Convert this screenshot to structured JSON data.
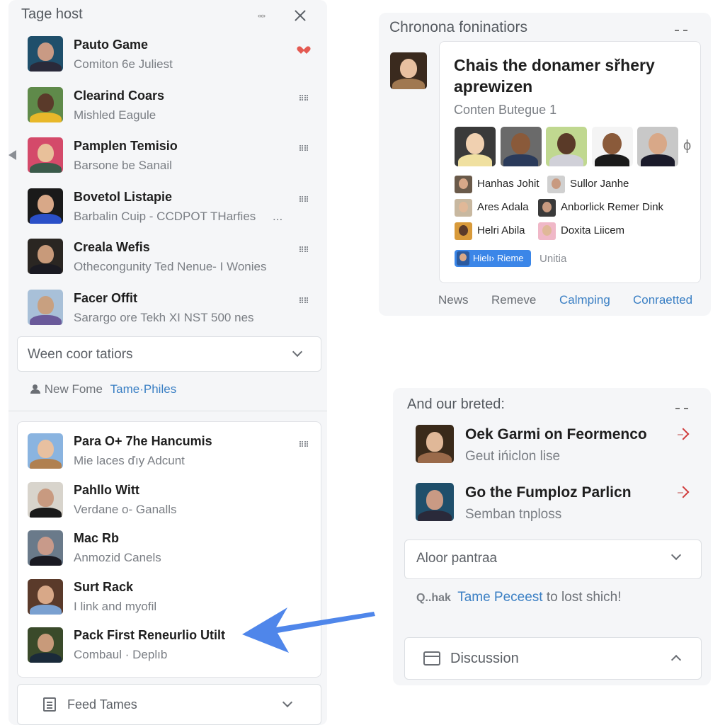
{
  "left_panel": {
    "title": "Tage host",
    "header_glyph": "«‹»",
    "items": [
      {
        "title": "Pauto Game",
        "subtitle": "Comiton 6e Juliest",
        "action_icon": "heart-icon",
        "avatar_colors": [
          "#1f4f6b",
          "#c99a84",
          "#2a2a3a"
        ]
      },
      {
        "title": "Clearind Coars",
        "subtitle": "Mishled Eagule",
        "action_icon": "menu-icon",
        "avatar_colors": [
          "#5f8a4a",
          "#5a3a2a",
          "#e8b82a"
        ]
      },
      {
        "title": "Pamplen Temisio",
        "subtitle": "Barsone be Sanail",
        "action_icon": "menu-icon",
        "avatar_colors": [
          "#d44a6a",
          "#e8c09a",
          "#3a5a4a"
        ]
      },
      {
        "title": "Bovetol Listapie",
        "subtitle": "Barbalin Cuip - CCDPOT THarfies",
        "trailing": "...",
        "action_icon": "menu-icon",
        "avatar_colors": [
          "#1a1a1a",
          "#d8a888",
          "#2a4fc8"
        ]
      },
      {
        "title": "Creala Wefis",
        "subtitle": "Othecongunity Ted Nenue- I Wonies",
        "action_icon": "menu-icon",
        "avatar_colors": [
          "#2a2622",
          "#c89a7a",
          "#1a1a22"
        ]
      },
      {
        "title": "Facer Offit",
        "subtitle": "Sarargo ore Tekh XI NST 500 nes",
        "action_icon": "menu-icon",
        "avatar_colors": [
          "#a8c0d8",
          "#c8a080",
          "#6a5a9a"
        ]
      }
    ],
    "dropdown": {
      "label": "Ween coor tatiors"
    },
    "footer_link": {
      "prefix": "New Fome",
      "link": "Tame·Philes"
    },
    "contacts": [
      {
        "title": "Para O+ 7he Hancumis",
        "subtitle": "Mie laces ďıy Adcunt",
        "action_icon": "menu-icon",
        "avatar_colors": [
          "#8ab4e0",
          "#e8c0a0",
          "#b08050"
        ]
      },
      {
        "title": "Pahllo Witt",
        "subtitle": "Verdane o- Ganalls",
        "avatar_colors": [
          "#d8d4cc",
          "#c89a80",
          "#1a1a1a"
        ]
      },
      {
        "title": "Mac Rb",
        "subtitle": "Anmozid Canels",
        "avatar_colors": [
          "#6a7a8a",
          "#c89a8a",
          "#1a1a22"
        ]
      },
      {
        "title": "Surt Rack",
        "subtitle": "I link and myofil",
        "avatar_colors": [
          "#5a3a2a",
          "#d8a888",
          "#7aa0d0"
        ]
      },
      {
        "title": "Pack First Reneurlio Utilt",
        "subtitle": "Combaul · Deplıb",
        "avatar_colors": [
          "#3a4a2a",
          "#c89a7a",
          "#1a2a3a"
        ]
      }
    ],
    "bottom_dropdown": {
      "label": "Feed Tames"
    }
  },
  "top_right_panel": {
    "title": "Chronona foninatiors",
    "card": {
      "title": "Chais the donamer sřhery aprewizen",
      "subtitle": "Conten Butegue 1",
      "faces": [
        {
          "colors": [
            "#3a3a3a",
            "#f0d0b0",
            "#f0e0a0"
          ]
        },
        {
          "colors": [
            "#6a6a6a",
            "#8a5a3a",
            "#2a3a5a"
          ]
        },
        {
          "colors": [
            "#c0d890",
            "#5a3a28",
            "#d0d0d8"
          ]
        },
        {
          "colors": [
            "#f4f4f4",
            "#8a5a3a",
            "#1a1a1a"
          ]
        },
        {
          "colors": [
            "#c8c8c8",
            "#d8a888",
            "#1a1a2a"
          ]
        }
      ],
      "more_glyph": "ϕ",
      "people": [
        {
          "name": "Hanhas Johit",
          "colors": [
            "#6a5a4a",
            "#d8a888"
          ]
        },
        {
          "name": "Sullor Janhe",
          "colors": [
            "#d0d0d0",
            "#c89a80"
          ]
        },
        {
          "name": "Ares Adala",
          "colors": [
            "#c8b8a0",
            "#e0b898"
          ]
        },
        {
          "name": "Anborlick Remer Dink",
          "colors": [
            "#3a3a3a",
            "#c89a80"
          ]
        },
        {
          "name": "Helri Abila",
          "colors": [
            "#d89a3a",
            "#5a3a2a"
          ]
        },
        {
          "name": "Doxita Liicem",
          "colors": [
            "#f0b8c8",
            "#e0b898"
          ]
        }
      ],
      "chip": {
        "label": "Hielı› Rieme"
      },
      "chip_side": "Unitia"
    },
    "tabs": [
      {
        "label": "News",
        "active": false
      },
      {
        "label": "Remeve",
        "active": false
      },
      {
        "label": "Calmping",
        "active": true
      },
      {
        "label": "Conraetted",
        "active": true
      }
    ]
  },
  "bottom_right_panel": {
    "title": "And our breted:",
    "items": [
      {
        "title": "Oek Garmi on Feormenco",
        "subtitle": "Geut ińiclon lise",
        "avatar_colors": [
          "#3a2a1a",
          "#e0b898",
          "#9a6a4a"
        ]
      },
      {
        "title": "Go the Fumploz Parlicn",
        "subtitle": "Semban tnploss",
        "avatar_colors": [
          "#1f4f6b",
          "#c99a84",
          "#2a2a3a"
        ]
      }
    ],
    "dropdown": {
      "label": "Aloor pantraa"
    },
    "link_line": {
      "prefix": "Q..hak",
      "link": "Tame Peceest",
      "suffix": "to lost shich!"
    },
    "discussion": {
      "label": "Discussion"
    }
  },
  "colors": {
    "accent_blue": "#3b86e8",
    "link_blue": "#3a7fc4",
    "heart_red": "#e45a52",
    "chevron_red": "#d03a3a",
    "arrow_blue": "#4f86ea"
  }
}
